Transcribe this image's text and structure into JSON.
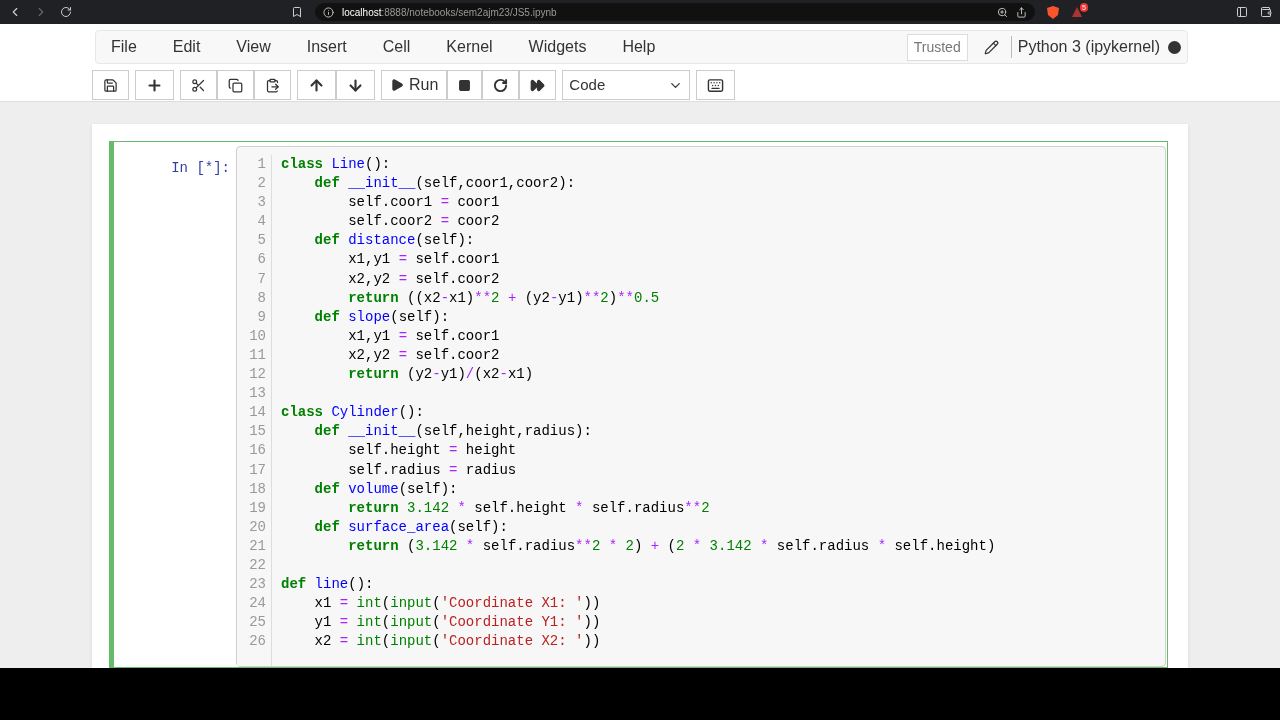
{
  "browser": {
    "url_host": "localhost",
    "url_rest": ":8888/notebooks/sem2ajm23/JS5.ipynb",
    "badge": "5"
  },
  "menu": [
    "File",
    "Edit",
    "View",
    "Insert",
    "Cell",
    "Kernel",
    "Widgets",
    "Help"
  ],
  "trusted": "Trusted",
  "kernel": {
    "name": "Python 3 (ipykernel)",
    "busy": true
  },
  "toolbar": {
    "run": "Run",
    "cell_type": "Code"
  },
  "cell": {
    "prompt": "In [*]:",
    "selected": true,
    "lines": [
      {
        "n": "1",
        "tokens": [
          {
            "kind": "k",
            "text": "class"
          },
          {
            "kind": "n",
            "text": " Line"
          },
          {
            "kind": "p",
            "text": "():"
          }
        ]
      },
      {
        "n": "2",
        "tokens": [
          {
            "kind": "k",
            "text": "    def"
          },
          {
            "kind": "n",
            "text": " __init__"
          },
          {
            "kind": "p",
            "text": "(self,coor1,coor2):"
          }
        ]
      },
      {
        "n": "3",
        "tokens": [
          {
            "kind": "p",
            "text": "        self.coor1 "
          },
          {
            "kind": "o",
            "text": "="
          },
          {
            "kind": "p",
            "text": " coor1"
          }
        ]
      },
      {
        "n": "4",
        "tokens": [
          {
            "kind": "p",
            "text": "        self.coor2 "
          },
          {
            "kind": "o",
            "text": "="
          },
          {
            "kind": "p",
            "text": " coor2"
          }
        ]
      },
      {
        "n": "5",
        "tokens": [
          {
            "kind": "k",
            "text": "    def"
          },
          {
            "kind": "n",
            "text": " distance"
          },
          {
            "kind": "p",
            "text": "(self):"
          }
        ]
      },
      {
        "n": "6",
        "tokens": [
          {
            "kind": "p",
            "text": "        x1,y1 "
          },
          {
            "kind": "o",
            "text": "="
          },
          {
            "kind": "p",
            "text": " self.coor1"
          }
        ]
      },
      {
        "n": "7",
        "tokens": [
          {
            "kind": "p",
            "text": "        x2,y2 "
          },
          {
            "kind": "o",
            "text": "="
          },
          {
            "kind": "p",
            "text": " self.coor2"
          }
        ]
      },
      {
        "n": "8",
        "tokens": [
          {
            "kind": "k",
            "text": "        return"
          },
          {
            "kind": "p",
            "text": " ((x2"
          },
          {
            "kind": "o",
            "text": "-"
          },
          {
            "kind": "p",
            "text": "x1)"
          },
          {
            "kind": "o",
            "text": "**"
          },
          {
            "kind": "m",
            "text": "2"
          },
          {
            "kind": "o",
            "text": " + "
          },
          {
            "kind": "p",
            "text": "(y2"
          },
          {
            "kind": "o",
            "text": "-"
          },
          {
            "kind": "p",
            "text": "y1)"
          },
          {
            "kind": "o",
            "text": "**"
          },
          {
            "kind": "m",
            "text": "2"
          },
          {
            "kind": "p",
            "text": ")"
          },
          {
            "kind": "o",
            "text": "**"
          },
          {
            "kind": "m",
            "text": "0.5"
          }
        ]
      },
      {
        "n": "9",
        "tokens": [
          {
            "kind": "k",
            "text": "    def"
          },
          {
            "kind": "n",
            "text": " slope"
          },
          {
            "kind": "p",
            "text": "(self):"
          }
        ]
      },
      {
        "n": "10",
        "tokens": [
          {
            "kind": "p",
            "text": "        x1,y1 "
          },
          {
            "kind": "o",
            "text": "="
          },
          {
            "kind": "p",
            "text": " self.coor1"
          }
        ]
      },
      {
        "n": "11",
        "tokens": [
          {
            "kind": "p",
            "text": "        x2,y2 "
          },
          {
            "kind": "o",
            "text": "="
          },
          {
            "kind": "p",
            "text": " self.coor2"
          }
        ]
      },
      {
        "n": "12",
        "tokens": [
          {
            "kind": "k",
            "text": "        return"
          },
          {
            "kind": "p",
            "text": " (y2"
          },
          {
            "kind": "o",
            "text": "-"
          },
          {
            "kind": "p",
            "text": "y1)"
          },
          {
            "kind": "o",
            "text": "/"
          },
          {
            "kind": "p",
            "text": "(x2"
          },
          {
            "kind": "o",
            "text": "-"
          },
          {
            "kind": "p",
            "text": "x1)"
          }
        ]
      },
      {
        "n": "13"
      },
      {
        "n": "14",
        "tokens": [
          {
            "kind": "k",
            "text": "class"
          },
          {
            "kind": "n",
            "text": " Cylinder"
          },
          {
            "kind": "p",
            "text": "():"
          }
        ]
      },
      {
        "n": "15",
        "tokens": [
          {
            "kind": "k",
            "text": "    def"
          },
          {
            "kind": "n",
            "text": " __init__"
          },
          {
            "kind": "p",
            "text": "(self,height,radius):"
          }
        ]
      },
      {
        "n": "16",
        "tokens": [
          {
            "kind": "p",
            "text": "        self.height "
          },
          {
            "kind": "o",
            "text": "="
          },
          {
            "kind": "p",
            "text": " height"
          }
        ]
      },
      {
        "n": "17",
        "tokens": [
          {
            "kind": "p",
            "text": "        self.radius "
          },
          {
            "kind": "o",
            "text": "="
          },
          {
            "kind": "p",
            "text": " radius"
          }
        ]
      },
      {
        "n": "18",
        "tokens": [
          {
            "kind": "k",
            "text": "    def"
          },
          {
            "kind": "n",
            "text": " volume"
          },
          {
            "kind": "p",
            "text": "(self):"
          }
        ]
      },
      {
        "n": "19",
        "tokens": [
          {
            "kind": "k",
            "text": "        return"
          },
          {
            "kind": "m",
            "text": " 3.142"
          },
          {
            "kind": "o",
            "text": " * "
          },
          {
            "kind": "p",
            "text": "self.height"
          },
          {
            "kind": "o",
            "text": " * "
          },
          {
            "kind": "p",
            "text": "self.radius"
          },
          {
            "kind": "o",
            "text": "**"
          },
          {
            "kind": "m",
            "text": "2"
          }
        ]
      },
      {
        "n": "20",
        "tokens": [
          {
            "kind": "k",
            "text": "    def"
          },
          {
            "kind": "n",
            "text": " surface_area"
          },
          {
            "kind": "p",
            "text": "(self):"
          }
        ]
      },
      {
        "n": "21",
        "tokens": [
          {
            "kind": "k",
            "text": "        return"
          },
          {
            "kind": "p",
            "text": " ("
          },
          {
            "kind": "m",
            "text": "3.142"
          },
          {
            "kind": "o",
            "text": " * "
          },
          {
            "kind": "p",
            "text": "self.radius"
          },
          {
            "kind": "o",
            "text": "**"
          },
          {
            "kind": "m",
            "text": "2"
          },
          {
            "kind": "o",
            "text": " * "
          },
          {
            "kind": "m",
            "text": "2"
          },
          {
            "kind": "p",
            "text": ")"
          },
          {
            "kind": "o",
            "text": " + "
          },
          {
            "kind": "p",
            "text": "("
          },
          {
            "kind": "m",
            "text": "2"
          },
          {
            "kind": "o",
            "text": " * "
          },
          {
            "kind": "m",
            "text": "3.142"
          },
          {
            "kind": "o",
            "text": " * "
          },
          {
            "kind": "p",
            "text": "self.radius"
          },
          {
            "kind": "o",
            "text": " * "
          },
          {
            "kind": "p",
            "text": "self.height)"
          }
        ]
      },
      {
        "n": "22"
      },
      {
        "n": "23",
        "tokens": [
          {
            "kind": "k",
            "text": "def"
          },
          {
            "kind": "n",
            "text": " line"
          },
          {
            "kind": "p",
            "text": "():"
          }
        ]
      },
      {
        "n": "24",
        "tokens": [
          {
            "kind": "p",
            "text": "    x1 "
          },
          {
            "kind": "o",
            "text": "="
          },
          {
            "kind": "b",
            "text": " int"
          },
          {
            "kind": "p",
            "text": "("
          },
          {
            "kind": "b",
            "text": "input"
          },
          {
            "kind": "p",
            "text": "("
          },
          {
            "kind": "s",
            "text": "'Coordinate X1: '"
          },
          {
            "kind": "p",
            "text": "))"
          }
        ]
      },
      {
        "n": "25",
        "tokens": [
          {
            "kind": "p",
            "text": "    y1 "
          },
          {
            "kind": "o",
            "text": "="
          },
          {
            "kind": "b",
            "text": " int"
          },
          {
            "kind": "p",
            "text": "("
          },
          {
            "kind": "b",
            "text": "input"
          },
          {
            "kind": "p",
            "text": "("
          },
          {
            "kind": "s",
            "text": "'Coordinate Y1: '"
          },
          {
            "kind": "p",
            "text": "))"
          }
        ]
      },
      {
        "n": "26",
        "tokens": [
          {
            "kind": "p",
            "text": "    x2 "
          },
          {
            "kind": "o",
            "text": "="
          },
          {
            "kind": "b",
            "text": " int"
          },
          {
            "kind": "p",
            "text": "("
          },
          {
            "kind": "b",
            "text": "input"
          },
          {
            "kind": "p",
            "text": "("
          },
          {
            "kind": "s",
            "text": "'Coordinate X2: '"
          },
          {
            "kind": "p",
            "text": "))"
          }
        ]
      }
    ]
  }
}
